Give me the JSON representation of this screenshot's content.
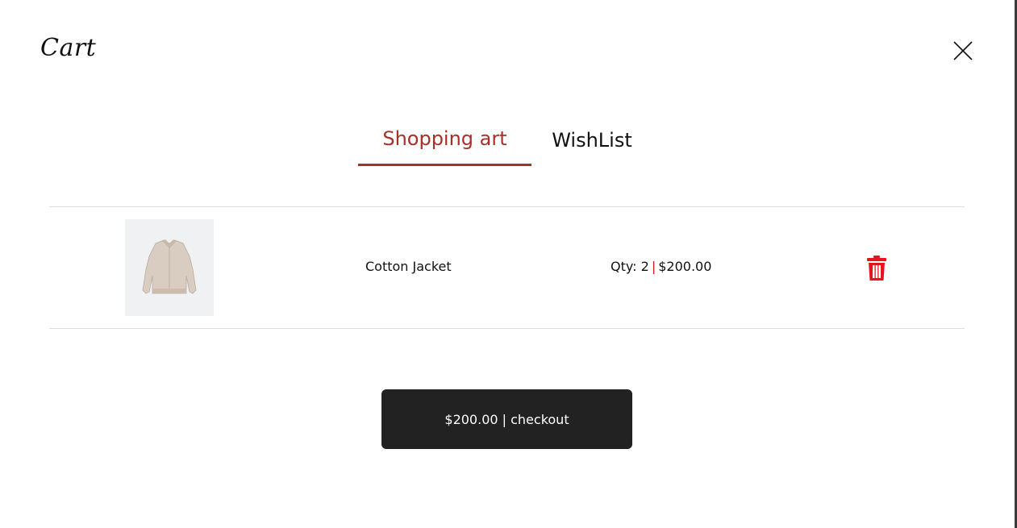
{
  "header": {
    "title": "Cart",
    "close_icon": "close-icon"
  },
  "tabs": [
    {
      "label": "Shopping art",
      "active": true
    },
    {
      "label": "WishList",
      "active": false
    }
  ],
  "cart": {
    "items": [
      {
        "name": "Cotton Jacket",
        "image_icon": "jacket-image",
        "qty_label": "Qty: 2",
        "separator": "|",
        "price": "$200.00",
        "delete_icon": "trash-icon"
      }
    ]
  },
  "checkout": {
    "label": "$200.00 | checkout"
  },
  "colors": {
    "accent": "#a83028",
    "delete": "#e8141b",
    "checkout_bg": "#222222",
    "divider": "#dcdcdc"
  }
}
